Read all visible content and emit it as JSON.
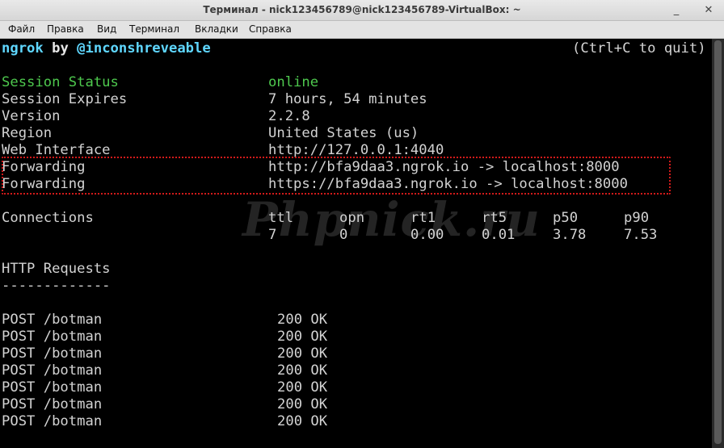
{
  "window": {
    "title": "Терминал - nick123456789@nick123456789-VirtualBox: ~",
    "controls": {
      "minimize": "_",
      "close": "✕"
    }
  },
  "menu": [
    "Файл",
    "Правка",
    "Вид",
    "Терминал",
    "Вкладки",
    "Справка"
  ],
  "header": {
    "app": "ngrok",
    "by": " by ",
    "author": "@inconshreveable",
    "quit_hint": "(Ctrl+C to quit)"
  },
  "session": {
    "status_label": "Session Status",
    "status_value": "online",
    "expires_label": "Session Expires",
    "expires_value": "7 hours, 54 minutes",
    "version_label": "Version",
    "version_value": "2.2.8",
    "region_label": "Region",
    "region_value": "United States (us)",
    "web_label": "Web Interface",
    "web_value": "http://127.0.0.1:4040",
    "fwd1_label": "Forwarding",
    "fwd1_value": "http://bfa9daa3.ngrok.io -> localhost:8000",
    "fwd2_label": "Forwarding",
    "fwd2_value": "https://bfa9daa3.ngrok.io -> localhost:8000"
  },
  "connections": {
    "label": "Connections",
    "columns": [
      "ttl",
      "opn",
      "rt1",
      "rt5",
      "p50",
      "p90"
    ],
    "values": [
      "7",
      "0",
      "0.00",
      "0.01",
      "3.78",
      "7.53"
    ]
  },
  "http": {
    "title": "HTTP Requests",
    "divider": "-------------",
    "requests": [
      {
        "request": "POST /botman",
        "status": "200 OK"
      },
      {
        "request": "POST /botman",
        "status": "200 OK"
      },
      {
        "request": "POST /botman",
        "status": "200 OK"
      },
      {
        "request": "POST /botman",
        "status": "200 OK"
      },
      {
        "request": "POST /botman",
        "status": "200 OK"
      },
      {
        "request": "POST /botman",
        "status": "200 OK"
      },
      {
        "request": "POST /botman",
        "status": "200 OK"
      }
    ]
  },
  "watermark": "Phpnick.ru"
}
